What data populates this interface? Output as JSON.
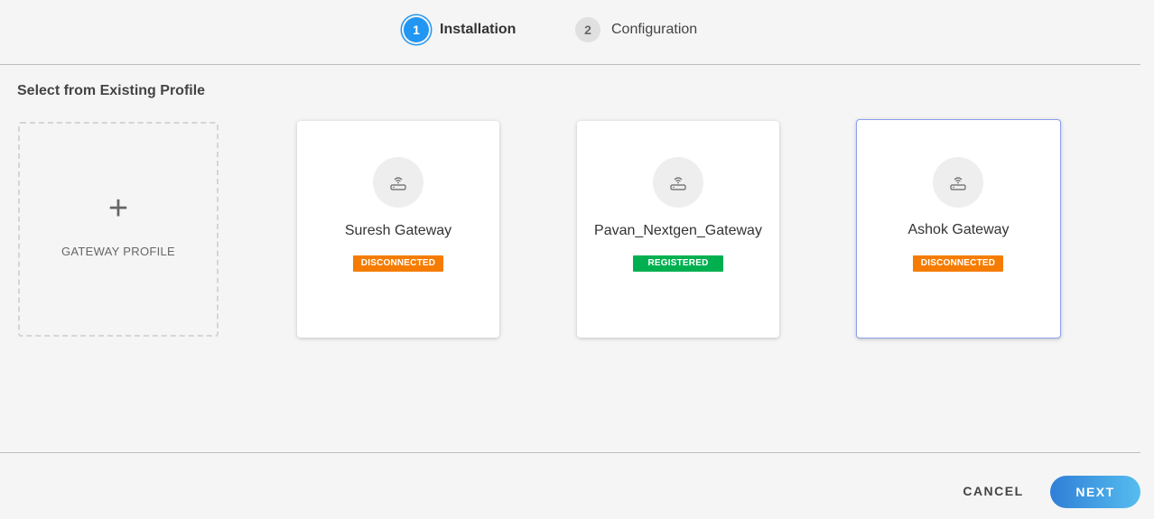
{
  "stepper": {
    "steps": [
      {
        "number": "1",
        "label": "Installation",
        "active": true
      },
      {
        "number": "2",
        "label": "Configuration",
        "active": false
      }
    ]
  },
  "section_title": "Select from Existing Profile",
  "add_card": {
    "symbol": "+",
    "label": "GATEWAY PROFILE"
  },
  "gateways": [
    {
      "name": "Suresh Gateway",
      "status": "DISCONNECTED",
      "status_color": "#f57c00",
      "icon": "router-wifi-icon"
    },
    {
      "name": "Pavan_Nextgen_Gateway",
      "status": "REGISTERED",
      "status_color": "#00b050",
      "icon": "router-wifi-icon"
    },
    {
      "name": "Ashok Gateway",
      "status": "DISCONNECTED",
      "status_color": "#f57c00",
      "icon": "router-wifi-icon",
      "selected": true
    }
  ],
  "footer": {
    "cancel_label": "CANCEL",
    "next_label": "NEXT"
  },
  "colors": {
    "accent": "#2196f3",
    "selected_border": "#8c9ff0"
  }
}
